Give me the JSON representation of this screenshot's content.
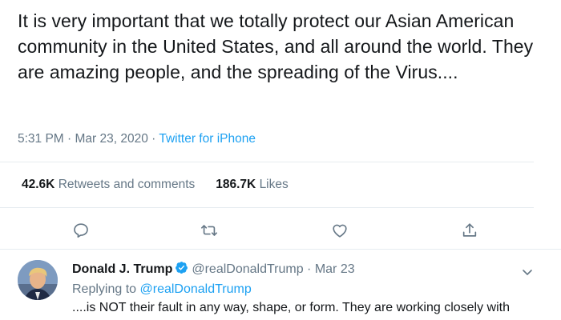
{
  "tweet": {
    "text": "It is very important that we totally protect our Asian American community in the United States, and all around the world. They are amazing people, and the spreading of the Virus....",
    "time": "5:31 PM",
    "separator": " · ",
    "date": "Mar 23, 2020",
    "source": "Twitter for iPhone",
    "retweets_count": "42.6K",
    "retweets_label": "Retweets and comments",
    "likes_count": "186.7K",
    "likes_label": "Likes",
    "actions": [
      "reply-icon",
      "retweet-icon",
      "like-icon",
      "share-icon"
    ]
  },
  "reply": {
    "name": "Donald J. Trump",
    "handle": "@realDonaldTrump",
    "separator": " · ",
    "date": "Mar 23",
    "replying_prefix": "Replying to ",
    "replying_to": "@realDonaldTrump",
    "text": "....is NOT their fault in any way, shape, or form. They are working closely with"
  },
  "colors": {
    "accent": "#1da1f2",
    "secondary_text": "#657786",
    "primary_text": "#14171a",
    "divider": "#e6ecf0"
  }
}
